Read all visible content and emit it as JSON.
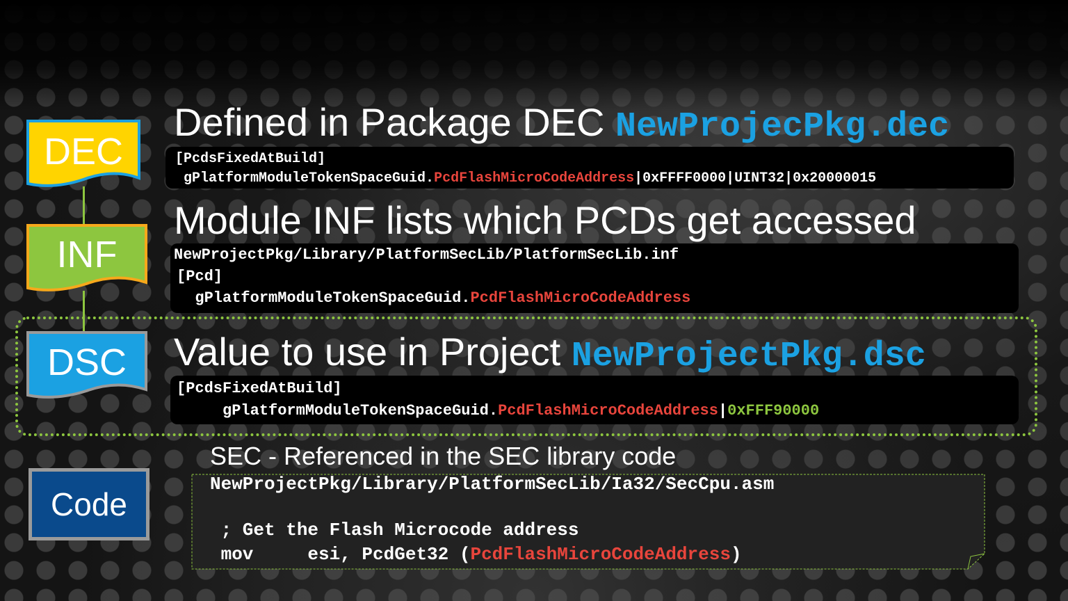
{
  "tags": {
    "dec": "DEC",
    "inf": "INF",
    "dsc": "DSC",
    "code": "Code"
  },
  "dec_section": {
    "heading": "Defined in Package DEC ",
    "file": "NewProjecPkg.dec",
    "line1": "[PcdsFixedAtBuild]",
    "line2_prefix": " gPlatformModuleTokenSpaceGuid.",
    "line2_pcd": "PcdFlashMicroCodeAddress",
    "line2_suffix": "|0xFFFF0000|UINT32|0x20000015"
  },
  "inf_section": {
    "heading": "Module INF lists which PCDs get accessed",
    "line1": "NewProjectPkg/Library/PlatformSecLib/PlatformSecLib.inf",
    "line2": "[Pcd]",
    "line3_prefix": "  gPlatformModuleTokenSpaceGuid.",
    "line3_pcd": "PcdFlashMicroCodeAddress"
  },
  "dsc_section": {
    "heading": "Value to use in Project ",
    "file": "NewProjectPkg.dsc",
    "line1": "[PcdsFixedAtBuild]",
    "line2_prefix": "     gPlatformModuleTokenSpaceGuid.",
    "line2_pcd": "PcdFlashMicroCodeAddress",
    "line2_sep": "|",
    "line2_value": "0xFFF90000"
  },
  "code_section": {
    "heading": "SEC - Referenced  in the SEC library code",
    "path": "NewProjectPkg/Library/PlatformSecLib/Ia32/SecCpu.asm",
    "comment": " ; Get the Flash Microcode address",
    "instr_prefix": " mov     esi, PcdGet32 (",
    "instr_pcd": "PcdFlashMicroCodeAddress",
    "instr_suffix": ")"
  },
  "colors": {
    "accent_blue": "#1ba1e2",
    "pcd_red": "#e8453c",
    "value_green": "#8dc63f",
    "dec_tag_fill": "#ffd400",
    "dec_tag_border": "#1ba1e2",
    "inf_tag_fill": "#8dc63f",
    "inf_tag_border": "#f7a81b",
    "dsc_tag_fill": "#1ba1e2",
    "dsc_tag_border": "#9a9a9a",
    "code_tag_fill": "#0a4a8c",
    "code_tag_border": "#9a9a9a"
  }
}
